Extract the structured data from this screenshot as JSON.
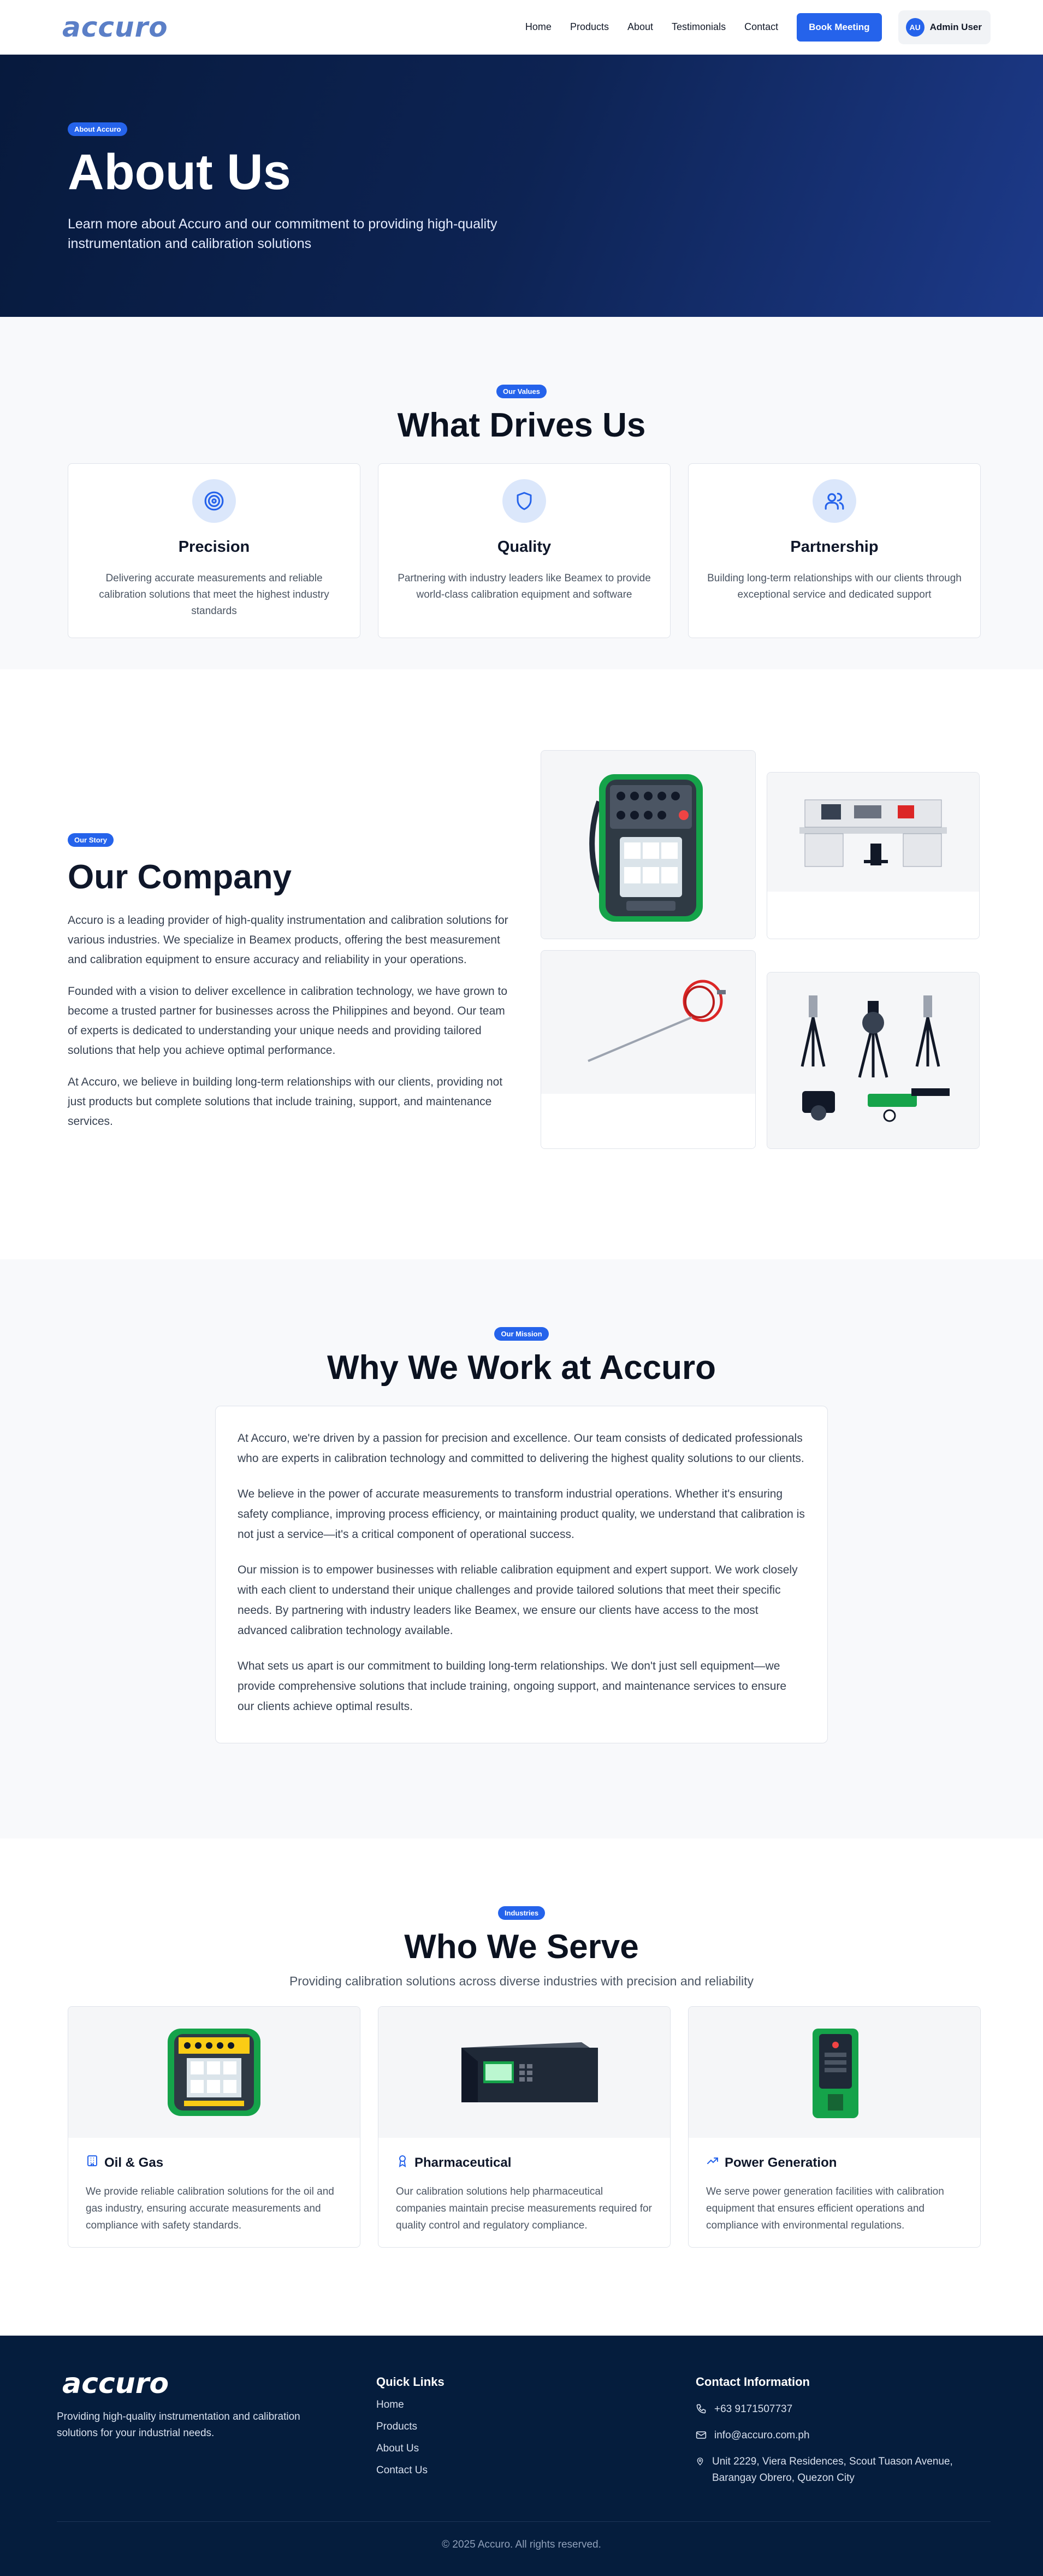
{
  "nav": {
    "logo": "accuro",
    "links": [
      "Home",
      "Products",
      "About",
      "Testimonials",
      "Contact"
    ],
    "cta": "Book Meeting",
    "user_initials": "AU",
    "user_name": "Admin User"
  },
  "hero": {
    "badge": "About Accuro",
    "title": "About Us",
    "subtitle": "Learn more about Accuro and our commitment to providing high-quality instrumentation and calibration solutions"
  },
  "values": {
    "badge": "Our Values",
    "title": "What Drives Us",
    "items": [
      {
        "icon": "target-icon",
        "title": "Precision",
        "text": "Delivering accurate measurements and reliable calibration solutions that meet the highest industry standards"
      },
      {
        "icon": "shield-icon",
        "title": "Quality",
        "text": "Partnering with industry leaders like Beamex to provide world-class calibration equipment and software"
      },
      {
        "icon": "users-icon",
        "title": "Partnership",
        "text": "Building long-term relationships with our clients through exceptional service and dedicated support"
      }
    ]
  },
  "company": {
    "badge": "Our Story",
    "title": "Our Company",
    "paragraphs": [
      "Accuro is a leading provider of high-quality instrumentation and calibration solutions for various industries. We specialize in Beamex products, offering the best measurement and calibration equipment to ensure accuracy and reliability in your operations.",
      "Founded with a vision to deliver excellence in calibration technology, we have grown to become a trusted partner for businesses across the Philippines and beyond. Our team of experts is dedicated to understanding your unique needs and providing tailored solutions that help you achieve optimal performance.",
      "At Accuro, we believe in building long-term relationships with our clients, providing not just products but complete solutions that include training, support, and maintenance services."
    ]
  },
  "mission": {
    "badge": "Our Mission",
    "title": "Why We Work at Accuro",
    "paragraphs": [
      "At Accuro, we're driven by a passion for precision and excellence. Our team consists of dedicated professionals who are experts in calibration technology and committed to delivering the highest quality solutions to our clients.",
      "We believe in the power of accurate measurements to transform industrial operations. Whether it's ensuring safety compliance, improving process efficiency, or maintaining product quality, we understand that calibration is not just a service—it's a critical component of operational success.",
      "Our mission is to empower businesses with reliable calibration equipment and expert support. We work closely with each client to understand their unique challenges and provide tailored solutions that meet their specific needs. By partnering with industry leaders like Beamex, we ensure our clients have access to the most advanced calibration technology available.",
      "What sets us apart is our commitment to building long-term relationships. We don't just sell equipment—we provide comprehensive solutions that include training, ongoing support, and maintenance services to ensure our clients achieve optimal results."
    ]
  },
  "industries": {
    "badge": "Industries",
    "title": "Who We Serve",
    "subtitle": "Providing calibration solutions across diverse industries with precision and reliability",
    "items": [
      {
        "icon": "building-icon",
        "title": "Oil & Gas",
        "text": "We provide reliable calibration solutions for the oil and gas industry, ensuring accurate measurements and compliance with safety standards."
      },
      {
        "icon": "award-icon",
        "title": "Pharmaceutical",
        "text": "Our calibration solutions help pharmaceutical companies maintain precise measurements required for quality control and regulatory compliance."
      },
      {
        "icon": "trending-up-icon",
        "title": "Power Generation",
        "text": "We serve power generation facilities with calibration equipment that ensures efficient operations and compliance with environmental regulations."
      }
    ]
  },
  "footer": {
    "logo": "accuro",
    "tagline": "Providing high-quality instrumentation and calibration solutions for your industrial needs.",
    "quick_links_title": "Quick Links",
    "quick_links": [
      "Home",
      "Products",
      "About Us",
      "Contact Us"
    ],
    "contact_title": "Contact Information",
    "phone": "+63 9171507737",
    "email": "info@accuro.com.ph",
    "address": "Unit 2229, Viera Residences, Scout Tuason Avenue, Barangay Obrero, Quezon City",
    "copyright": "© 2025 Accuro. All rights reserved."
  },
  "colors": {
    "accent": "#2563eb",
    "hero_dark": "#071a3d",
    "footer_bg": "#051d3d",
    "logo_blue": "#5b7fc7"
  }
}
